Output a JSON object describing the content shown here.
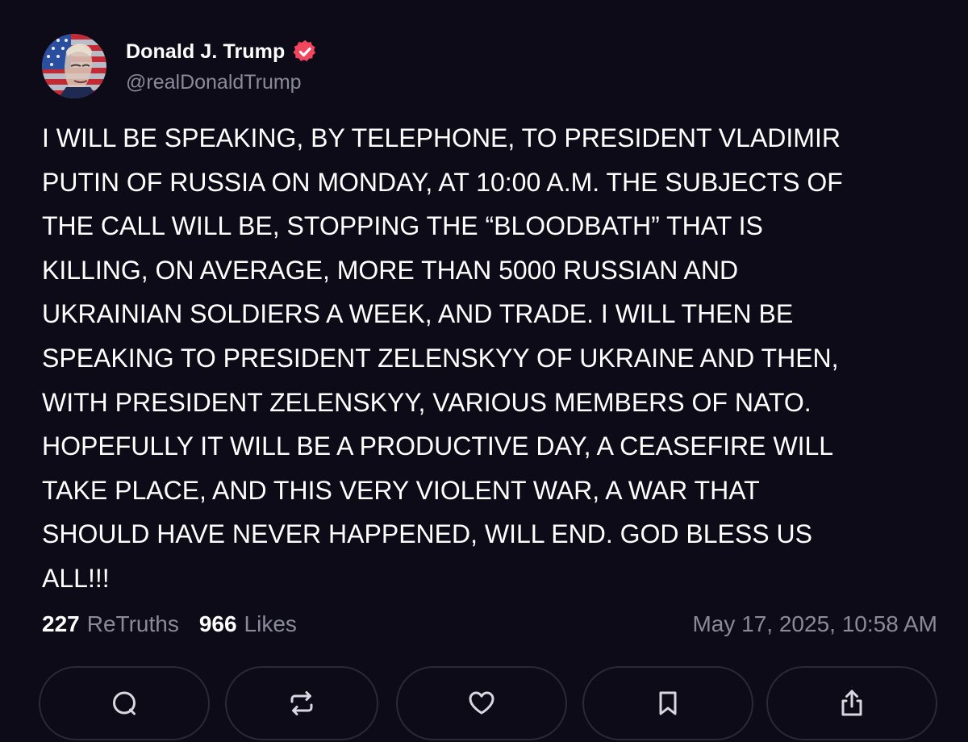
{
  "author": {
    "display_name": "Donald J. Trump",
    "handle": "@realDonaldTrump",
    "verified_color": "#f0475f"
  },
  "post": {
    "text": "I WILL BE SPEAKING, BY TELEPHONE, TO PRESIDENT VLADIMIR\nPUTIN OF RUSSIA ON MONDAY, AT 10:00 A.M. THE SUBJECTS OF\nTHE CALL WILL BE, STOPPING THE “BLOODBATH” THAT IS\nKILLING, ON AVERAGE, MORE THAN 5000 RUSSIAN AND\nUKRAINIAN SOLDIERS A WEEK, AND TRADE. I WILL THEN BE\nSPEAKING TO PRESIDENT ZELENSKYY OF UKRAINE AND THEN,\nWITH PRESIDENT ZELENSKYY, VARIOUS MEMBERS OF NATO.\nHOPEFULLY IT WILL BE A PRODUCTIVE DAY, A CEASEFIRE WILL\nTAKE PLACE, AND THIS VERY VIOLENT WAR, A WAR THAT\nSHOULD HAVE NEVER HAPPENED, WILL END. GOD BLESS US\nALL!!!"
  },
  "stats": {
    "retruths_count": "227",
    "retruths_label": "ReTruths",
    "likes_count": "966",
    "likes_label": "Likes",
    "timestamp": "May 17, 2025, 10:58 AM"
  },
  "actions": [
    {
      "icon": "comment-icon"
    },
    {
      "icon": "retruth-icon"
    },
    {
      "icon": "like-icon"
    },
    {
      "icon": "bookmark-icon"
    },
    {
      "icon": "share-icon"
    }
  ],
  "colors": {
    "background": "#0d0b17",
    "text_primary": "#ffffff",
    "text_secondary": "#8b8a98",
    "button_border": "#2b2938",
    "icon_color": "#d9d8e0"
  }
}
